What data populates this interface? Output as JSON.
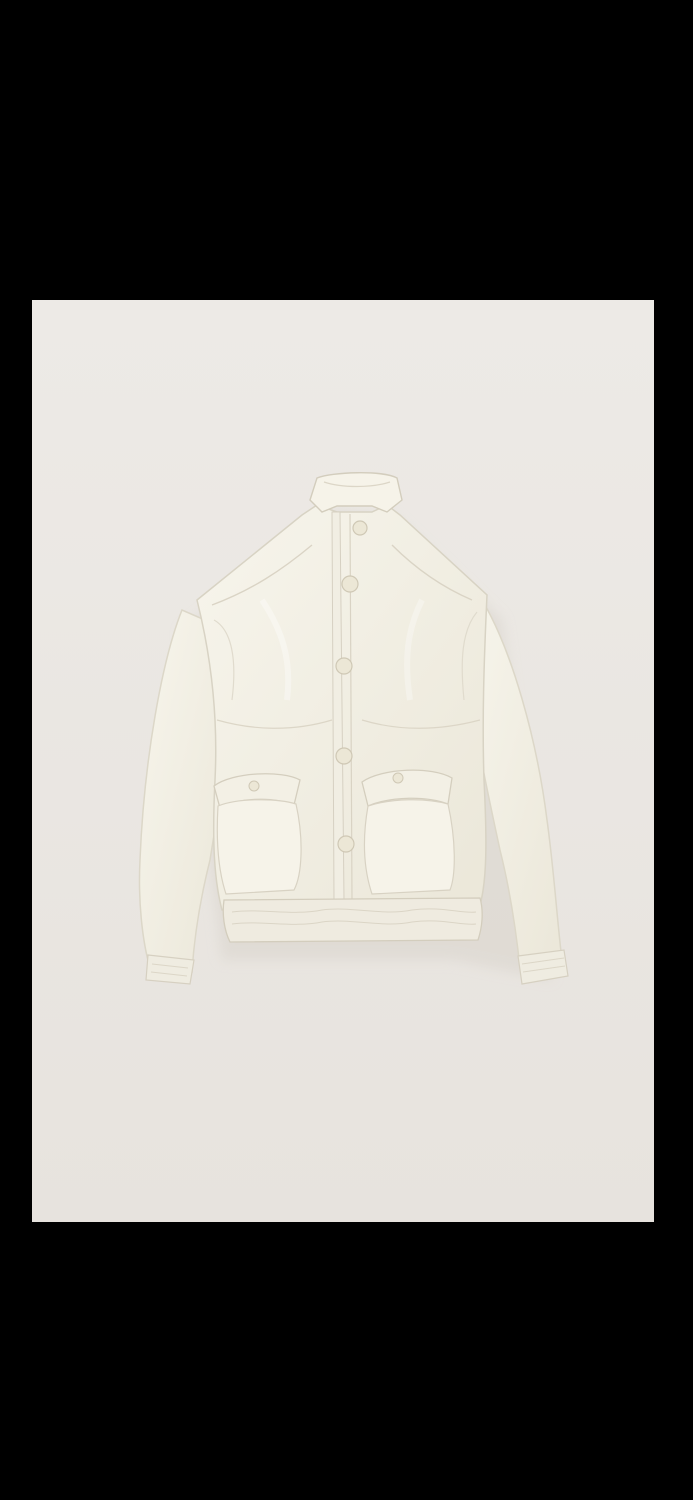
{
  "viewer": {
    "background_color": "#000000"
  },
  "photo": {
    "subject_icon": "jacket-photo",
    "background_color": "#ebe8e3",
    "garment_color": "#f4f1e6"
  }
}
